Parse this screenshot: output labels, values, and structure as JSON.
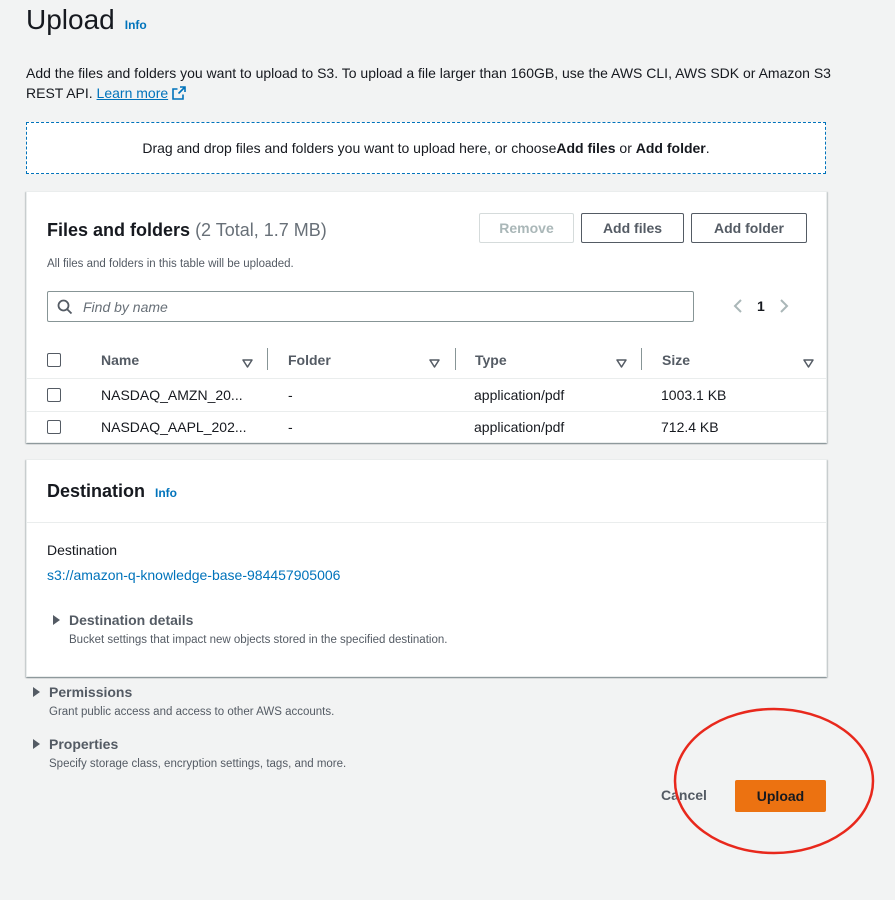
{
  "header": {
    "title": "Upload",
    "info_label": "Info",
    "description": "Add the files and folders you want to upload to S3. To upload a file larger than 160GB, use the AWS CLI, AWS SDK or Amazon S3 REST API. ",
    "learn_more": "Learn more"
  },
  "dropzone": {
    "text_prefix": "Drag and drop files and folders you want to upload here, or choose ",
    "add_files": "Add files",
    "or": " or ",
    "add_folder": "Add folder",
    "suffix": "."
  },
  "files_panel": {
    "title": "Files and folders",
    "count": "(2 Total, 1.7 MB)",
    "subtitle": "All files and folders in this table will be uploaded.",
    "remove_label": "Remove",
    "add_files_label": "Add files",
    "add_folder_label": "Add folder",
    "search_placeholder": "Find by name",
    "page": "1",
    "columns": [
      "Name",
      "Folder",
      "Type",
      "Size"
    ],
    "rows": [
      {
        "name": "NASDAQ_AMZN_20...",
        "folder": "-",
        "type": "application/pdf",
        "size": "1003.1 KB"
      },
      {
        "name": "NASDAQ_AAPL_202...",
        "folder": "-",
        "type": "application/pdf",
        "size": "712.4 KB"
      }
    ]
  },
  "destination": {
    "title": "Destination",
    "info_label": "Info",
    "label": "Destination",
    "uri": "s3://amazon-q-knowledge-base-984457905006",
    "details_title": "Destination details",
    "details_desc": "Bucket settings that impact new objects stored in the specified destination."
  },
  "permissions": {
    "title": "Permissions",
    "desc": "Grant public access and access to other AWS accounts."
  },
  "properties": {
    "title": "Properties",
    "desc": "Specify storage class, encryption settings, tags, and more."
  },
  "footer": {
    "cancel_label": "Cancel",
    "upload_label": "Upload"
  },
  "colors": {
    "link": "#0073bb",
    "primary_button": "#ec7211",
    "annotation_circle": "#e8281c"
  }
}
